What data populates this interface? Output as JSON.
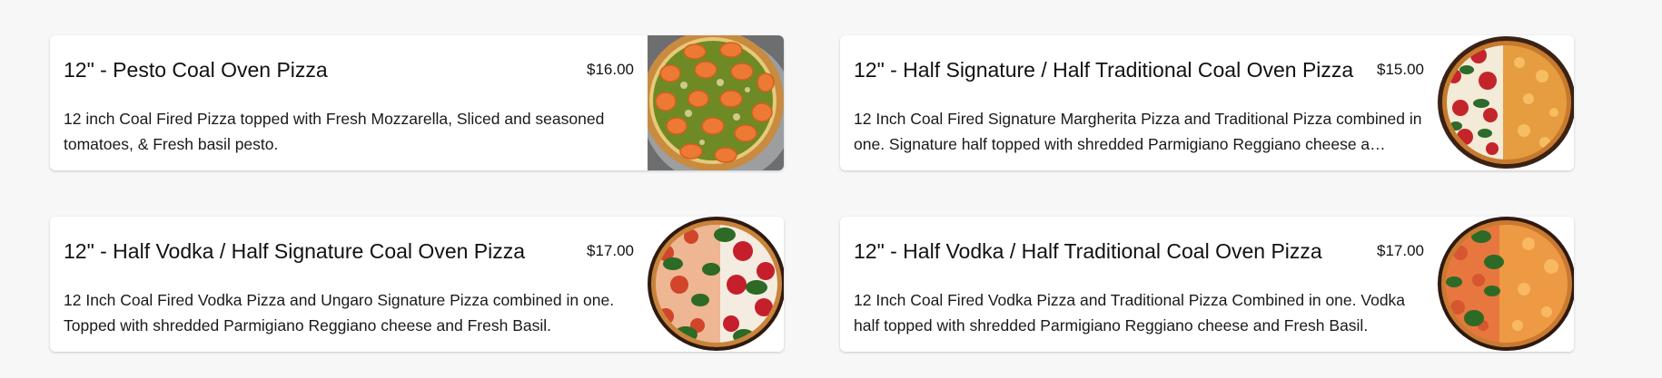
{
  "menu": {
    "items": [
      {
        "title": "12\" - Pesto Coal Oven Pizza",
        "price": "$16.00",
        "description": "12 inch Coal Fired Pizza topped with Fresh Mozzarella, Sliced and seasoned tomatoes, & Fresh basil pesto.",
        "image": "pesto-pizza-photo"
      },
      {
        "title": "12\" - Half Signature / Half Traditional Coal Oven Pizza",
        "price": "$15.00",
        "description": "12 Inch Coal Fired Signature Margherita Pizza and Traditional Pizza combined in one. Signature half topped with shredded Parmigiano Reggiano cheese a…",
        "image": "half-signature-half-traditional-pizza-photo"
      },
      {
        "title": "12\" - Half Vodka / Half Signature Coal Oven Pizza",
        "price": "$17.00",
        "description": "12 Inch Coal Fired Vodka Pizza and Ungaro Signature Pizza combined in one. Topped with shredded Parmigiano Reggiano cheese and Fresh Basil.",
        "image": "half-vodka-half-signature-pizza-photo"
      },
      {
        "title": "12\" - Half Vodka / Half Traditional Coal Oven Pizza",
        "price": "$17.00",
        "description": "12 Inch Coal Fired Vodka Pizza and Traditional Pizza Combined in one. Vodka half topped with shredded Parmigiano Reggiano cheese and Fresh Basil.",
        "image": "half-vodka-half-traditional-pizza-photo"
      }
    ]
  },
  "colors": {
    "page_background": "#f7f7f7",
    "card_background": "#ffffff",
    "text": "#111111"
  }
}
